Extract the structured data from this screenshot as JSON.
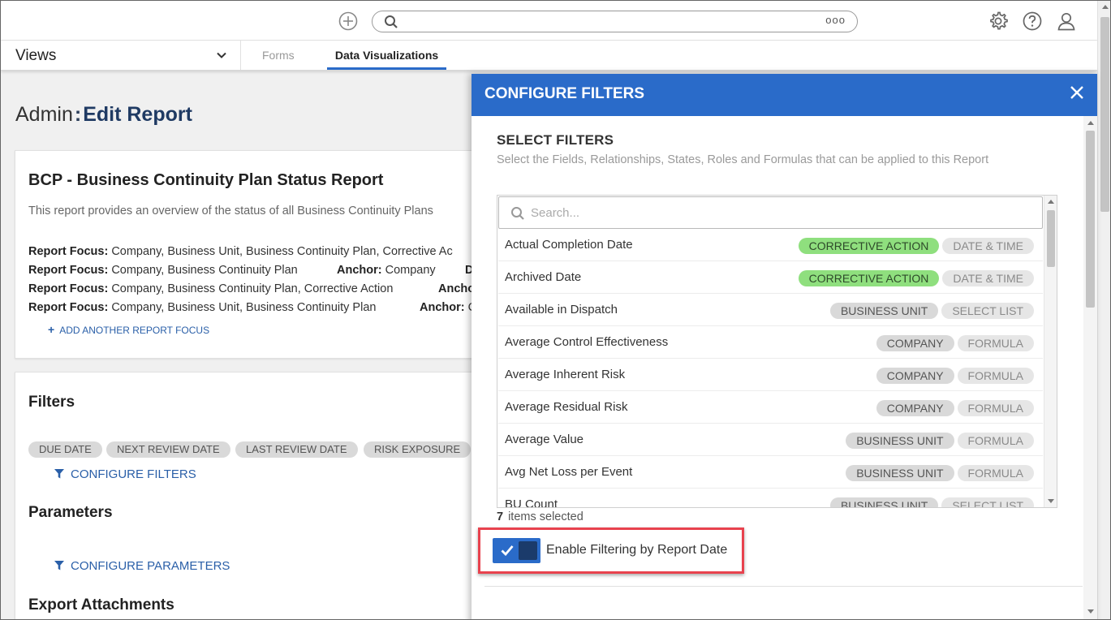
{
  "views": {
    "label": "Views"
  },
  "tabs": {
    "forms": "Forms",
    "data_viz": "Data Visualizations"
  },
  "search": {
    "menu_dots": "ooo"
  },
  "page": {
    "breadcrumb": "Admin",
    "separator": ":",
    "title": "Edit Report"
  },
  "report": {
    "title": "BCP - Business Continuity Plan Status Report",
    "description": "This report provides an overview of the status of all Business Continuity Plans",
    "focus_label": "Report Focus:",
    "anchor_label": "Anchor:",
    "focus_lines": [
      {
        "focus": "Company, Business Unit, Business Continuity Plan, Corrective Ac",
        "anchor": ""
      },
      {
        "focus": "Company, Business Continuity Plan",
        "anchor": "Company",
        "extra": "D"
      },
      {
        "focus": "Company, Business Continuity Plan, Corrective Action",
        "anchor": ""
      },
      {
        "focus": "Company, Business Unit, Business Continuity Plan",
        "anchor": "C"
      }
    ],
    "add_focus": "ADD ANOTHER REPORT FOCUS"
  },
  "filters": {
    "heading": "Filters",
    "chips": [
      "DUE DATE",
      "NEXT REVIEW DATE",
      "LAST REVIEW DATE",
      "RISK EXPOSURE"
    ],
    "configure_link": "CONFIGURE FILTERS"
  },
  "parameters": {
    "heading": "Parameters",
    "configure_link": "CONFIGURE PARAMETERS"
  },
  "export": {
    "heading": "Export Attachments"
  },
  "modal": {
    "title": "CONFIGURE FILTERS",
    "section_title": "SELECT FILTERS",
    "section_subtitle": "Select the Fields, Relationships, States, Roles and Formulas that can be applied to this Report",
    "search_placeholder": "Search...",
    "rows": [
      {
        "name": "Actual Completion Date",
        "tag1": "CORRECTIVE ACTION",
        "tag2": "DATE & TIME"
      },
      {
        "name": "Archived Date",
        "tag1": "CORRECTIVE ACTION",
        "tag2": "DATE & TIME"
      },
      {
        "name": "Available in Dispatch",
        "tag1": "BUSINESS UNIT",
        "tag2": "SELECT LIST"
      },
      {
        "name": "Average Control Effectiveness",
        "tag1": "COMPANY",
        "tag2": "FORMULA"
      },
      {
        "name": "Average Inherent Risk",
        "tag1": "COMPANY",
        "tag2": "FORMULA"
      },
      {
        "name": "Average Residual Risk",
        "tag1": "COMPANY",
        "tag2": "FORMULA"
      },
      {
        "name": "Average Value",
        "tag1": "BUSINESS UNIT",
        "tag2": "FORMULA"
      },
      {
        "name": "Avg Net Loss per Event",
        "tag1": "BUSINESS UNIT",
        "tag2": "FORMULA"
      },
      {
        "name": "BU Count",
        "tag1": "BUSINESS UNIT",
        "tag2": "SELECT LIST"
      }
    ],
    "items_selected_count": "7",
    "items_selected_label": "items selected",
    "toggle_label": "Enable Filtering by Report Date",
    "toggle_on": true
  },
  "colors": {
    "accent": "#2a6bc9",
    "tag_green": "#8fdf7e",
    "highlight": "#e8424e"
  }
}
